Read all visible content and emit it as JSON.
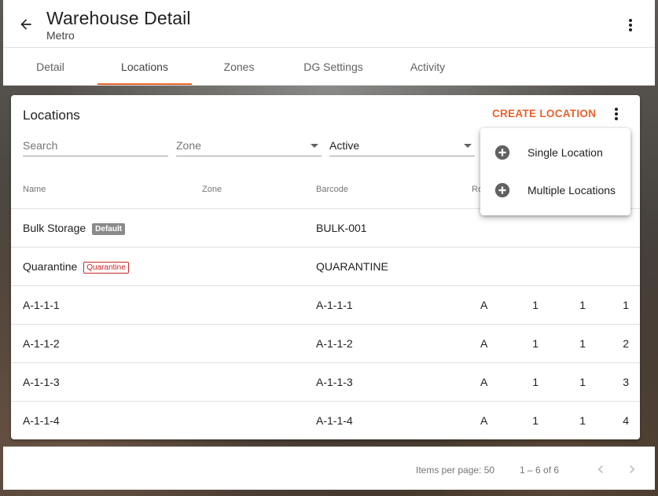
{
  "header": {
    "title": "Warehouse Detail",
    "subtitle": "Metro"
  },
  "tabs": [
    {
      "label": "Detail"
    },
    {
      "label": "Locations"
    },
    {
      "label": "Zones"
    },
    {
      "label": "DG Settings"
    },
    {
      "label": "Activity"
    }
  ],
  "active_tab": "Locations",
  "accent_color": "#e8632c",
  "card": {
    "title": "Locations",
    "create_label": "CREATE LOCATION"
  },
  "filters": {
    "search_placeholder": "Search",
    "zone_placeholder": "Zone",
    "status_value": "Active"
  },
  "columns": [
    "Name",
    "Zone",
    "Barcode",
    "Ro"
  ],
  "rows": [
    {
      "name": "Bulk Storage",
      "badge": "Default",
      "zone": "",
      "barcode": "BULK-001",
      "row": "",
      "c1": "",
      "c2": "",
      "c3": ""
    },
    {
      "name": "Quarantine",
      "badge": "Quarantine",
      "zone": "",
      "barcode": "QUARANTINE",
      "row": "",
      "c1": "",
      "c2": "",
      "c3": ""
    },
    {
      "name": "A-1-1-1",
      "zone": "",
      "barcode": "A-1-1-1",
      "row": "A",
      "c1": "1",
      "c2": "1",
      "c3": "1"
    },
    {
      "name": "A-1-1-2",
      "zone": "",
      "barcode": "A-1-1-2",
      "row": "A",
      "c1": "1",
      "c2": "1",
      "c3": "2"
    },
    {
      "name": "A-1-1-3",
      "zone": "",
      "barcode": "A-1-1-3",
      "row": "A",
      "c1": "1",
      "c2": "1",
      "c3": "3"
    },
    {
      "name": "A-1-1-4",
      "zone": "",
      "barcode": "A-1-1-4",
      "row": "A",
      "c1": "1",
      "c2": "1",
      "c3": "4"
    }
  ],
  "menu": {
    "items": [
      {
        "label": "Single Location",
        "icon": "add-circle-icon"
      },
      {
        "label": "Multiple Locations",
        "icon": "add-circle-icon"
      }
    ]
  },
  "pagination": {
    "items_per_page_label": "Items per page: 50",
    "range_label": "1 – 6 of 6"
  }
}
